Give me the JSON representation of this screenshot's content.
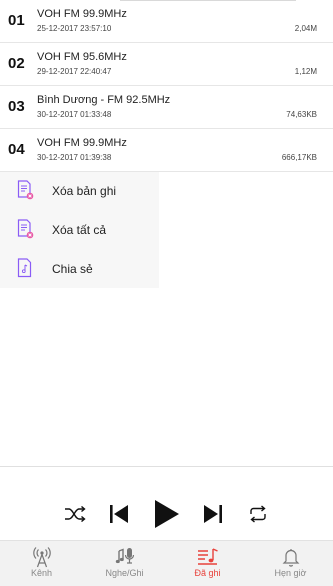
{
  "recordings": [
    {
      "num": "01",
      "title": "VOH FM 99.9MHz",
      "date": "25-12-2017 23:57:10",
      "size": "2,04M"
    },
    {
      "num": "02",
      "title": "VOH FM 95.6MHz",
      "date": "29-12-2017 22:40:47",
      "size": "1,12M"
    },
    {
      "num": "03",
      "title": "Bình Dương - FM 92.5MHz",
      "date": "30-12-2017 01:33:48",
      "size": "74,63KB"
    },
    {
      "num": "04",
      "title": "VOH FM 99.9MHz",
      "date": "30-12-2017 01:39:38",
      "size": "666,17KB"
    }
  ],
  "context_menu": {
    "delete_record": "Xóa bản ghi",
    "delete_all": "Xóa tất cả",
    "share": "Chia sẻ"
  },
  "player": {
    "shuffle_icon": "shuffle-icon",
    "previous_icon": "skip-previous-icon",
    "play_icon": "play-icon",
    "next_icon": "skip-next-icon",
    "repeat_icon": "repeat-icon"
  },
  "tabs": {
    "channels": "Kênh",
    "listen_record": "Nghe/Ghi",
    "recorded": "Đã ghi",
    "timer": "Hẹn giờ"
  },
  "colors": {
    "accent": "#e8413b",
    "menu_icon": "#8a5cf6",
    "tab_inactive": "#888888"
  }
}
